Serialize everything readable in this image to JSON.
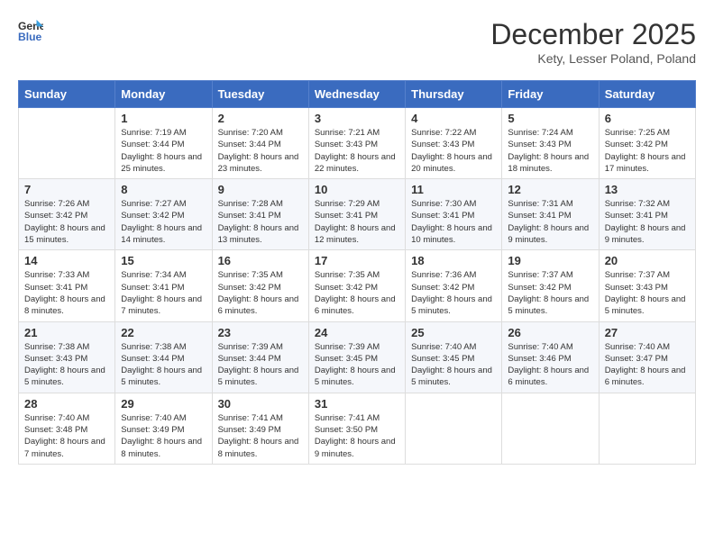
{
  "header": {
    "logo_line1": "General",
    "logo_line2": "Blue",
    "month": "December 2025",
    "location": "Kety, Lesser Poland, Poland"
  },
  "weekdays": [
    "Sunday",
    "Monday",
    "Tuesday",
    "Wednesday",
    "Thursday",
    "Friday",
    "Saturday"
  ],
  "weeks": [
    [
      {
        "day": "",
        "sunrise": "",
        "sunset": "",
        "daylight": ""
      },
      {
        "day": "1",
        "sunrise": "7:19 AM",
        "sunset": "3:44 PM",
        "daylight": "8 hours and 25 minutes."
      },
      {
        "day": "2",
        "sunrise": "7:20 AM",
        "sunset": "3:44 PM",
        "daylight": "8 hours and 23 minutes."
      },
      {
        "day": "3",
        "sunrise": "7:21 AM",
        "sunset": "3:43 PM",
        "daylight": "8 hours and 22 minutes."
      },
      {
        "day": "4",
        "sunrise": "7:22 AM",
        "sunset": "3:43 PM",
        "daylight": "8 hours and 20 minutes."
      },
      {
        "day": "5",
        "sunrise": "7:24 AM",
        "sunset": "3:43 PM",
        "daylight": "8 hours and 18 minutes."
      },
      {
        "day": "6",
        "sunrise": "7:25 AM",
        "sunset": "3:42 PM",
        "daylight": "8 hours and 17 minutes."
      }
    ],
    [
      {
        "day": "7",
        "sunrise": "7:26 AM",
        "sunset": "3:42 PM",
        "daylight": "8 hours and 15 minutes."
      },
      {
        "day": "8",
        "sunrise": "7:27 AM",
        "sunset": "3:42 PM",
        "daylight": "8 hours and 14 minutes."
      },
      {
        "day": "9",
        "sunrise": "7:28 AM",
        "sunset": "3:41 PM",
        "daylight": "8 hours and 13 minutes."
      },
      {
        "day": "10",
        "sunrise": "7:29 AM",
        "sunset": "3:41 PM",
        "daylight": "8 hours and 12 minutes."
      },
      {
        "day": "11",
        "sunrise": "7:30 AM",
        "sunset": "3:41 PM",
        "daylight": "8 hours and 10 minutes."
      },
      {
        "day": "12",
        "sunrise": "7:31 AM",
        "sunset": "3:41 PM",
        "daylight": "8 hours and 9 minutes."
      },
      {
        "day": "13",
        "sunrise": "7:32 AM",
        "sunset": "3:41 PM",
        "daylight": "8 hours and 9 minutes."
      }
    ],
    [
      {
        "day": "14",
        "sunrise": "7:33 AM",
        "sunset": "3:41 PM",
        "daylight": "8 hours and 8 minutes."
      },
      {
        "day": "15",
        "sunrise": "7:34 AM",
        "sunset": "3:41 PM",
        "daylight": "8 hours and 7 minutes."
      },
      {
        "day": "16",
        "sunrise": "7:35 AM",
        "sunset": "3:42 PM",
        "daylight": "8 hours and 6 minutes."
      },
      {
        "day": "17",
        "sunrise": "7:35 AM",
        "sunset": "3:42 PM",
        "daylight": "8 hours and 6 minutes."
      },
      {
        "day": "18",
        "sunrise": "7:36 AM",
        "sunset": "3:42 PM",
        "daylight": "8 hours and 5 minutes."
      },
      {
        "day": "19",
        "sunrise": "7:37 AM",
        "sunset": "3:42 PM",
        "daylight": "8 hours and 5 minutes."
      },
      {
        "day": "20",
        "sunrise": "7:37 AM",
        "sunset": "3:43 PM",
        "daylight": "8 hours and 5 minutes."
      }
    ],
    [
      {
        "day": "21",
        "sunrise": "7:38 AM",
        "sunset": "3:43 PM",
        "daylight": "8 hours and 5 minutes."
      },
      {
        "day": "22",
        "sunrise": "7:38 AM",
        "sunset": "3:44 PM",
        "daylight": "8 hours and 5 minutes."
      },
      {
        "day": "23",
        "sunrise": "7:39 AM",
        "sunset": "3:44 PM",
        "daylight": "8 hours and 5 minutes."
      },
      {
        "day": "24",
        "sunrise": "7:39 AM",
        "sunset": "3:45 PM",
        "daylight": "8 hours and 5 minutes."
      },
      {
        "day": "25",
        "sunrise": "7:40 AM",
        "sunset": "3:45 PM",
        "daylight": "8 hours and 5 minutes."
      },
      {
        "day": "26",
        "sunrise": "7:40 AM",
        "sunset": "3:46 PM",
        "daylight": "8 hours and 6 minutes."
      },
      {
        "day": "27",
        "sunrise": "7:40 AM",
        "sunset": "3:47 PM",
        "daylight": "8 hours and 6 minutes."
      }
    ],
    [
      {
        "day": "28",
        "sunrise": "7:40 AM",
        "sunset": "3:48 PM",
        "daylight": "8 hours and 7 minutes."
      },
      {
        "day": "29",
        "sunrise": "7:40 AM",
        "sunset": "3:49 PM",
        "daylight": "8 hours and 8 minutes."
      },
      {
        "day": "30",
        "sunrise": "7:41 AM",
        "sunset": "3:49 PM",
        "daylight": "8 hours and 8 minutes."
      },
      {
        "day": "31",
        "sunrise": "7:41 AM",
        "sunset": "3:50 PM",
        "daylight": "8 hours and 9 minutes."
      },
      {
        "day": "",
        "sunrise": "",
        "sunset": "",
        "daylight": ""
      },
      {
        "day": "",
        "sunrise": "",
        "sunset": "",
        "daylight": ""
      },
      {
        "day": "",
        "sunrise": "",
        "sunset": "",
        "daylight": ""
      }
    ]
  ],
  "labels": {
    "sunrise": "Sunrise:",
    "sunset": "Sunset:",
    "daylight": "Daylight:"
  }
}
